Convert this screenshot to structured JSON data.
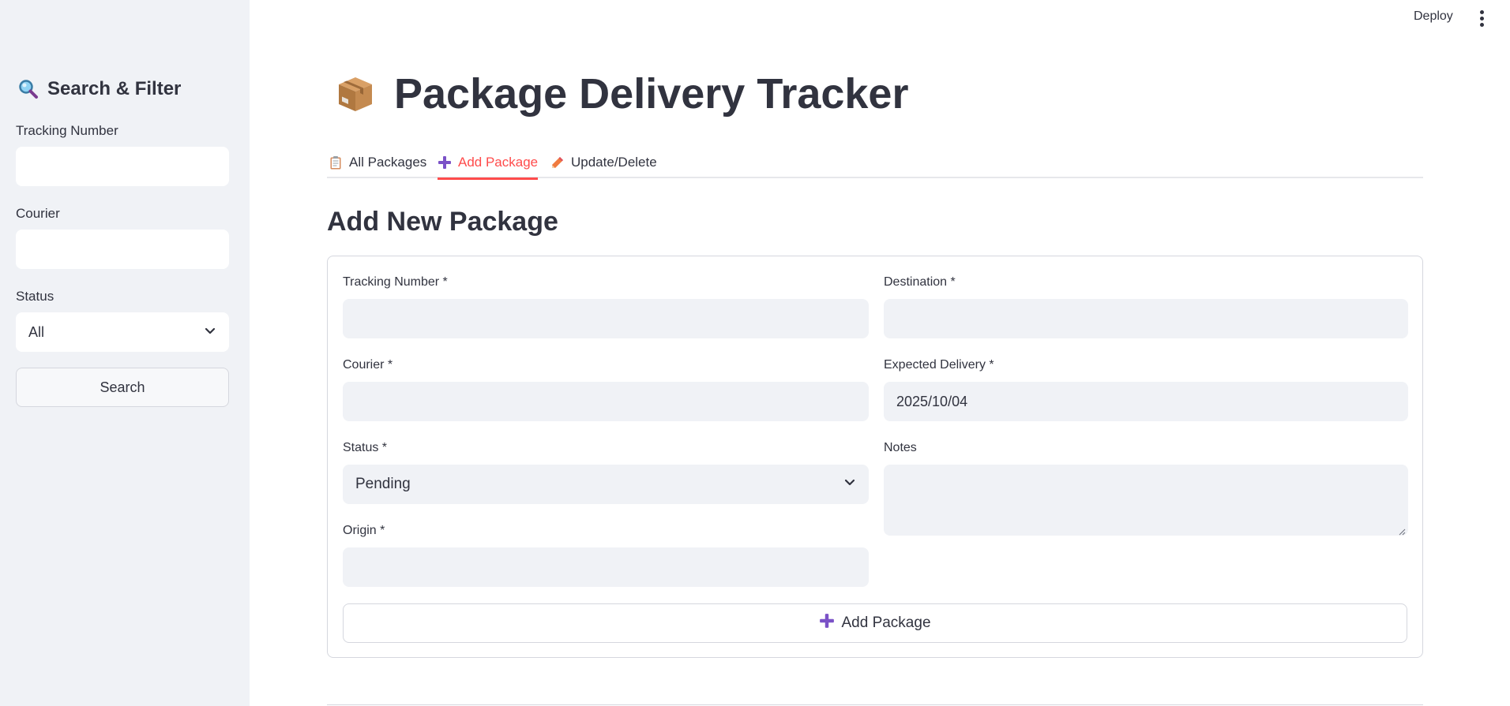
{
  "sidebar": {
    "title": "Search & Filter",
    "title_icon": "magnifier-icon",
    "tracking_label": "Tracking Number",
    "tracking_value": "",
    "courier_label": "Courier",
    "courier_value": "",
    "status_label": "Status",
    "status_value": "All",
    "search_button": "Search"
  },
  "header": {
    "deploy_label": "Deploy",
    "menu_icon": "kebab-menu-icon"
  },
  "main": {
    "title": "Package Delivery Tracker",
    "title_icon": "package-icon",
    "tabs": [
      {
        "label": "All Packages",
        "icon": "clipboard-icon",
        "active": false
      },
      {
        "label": "Add Package",
        "icon": "plus-icon",
        "active": true
      },
      {
        "label": "Update/Delete",
        "icon": "pencil-icon",
        "active": false
      }
    ],
    "section_title": "Add New Package",
    "form": {
      "tracking_label": "Tracking Number *",
      "tracking_value": "",
      "destination_label": "Destination *",
      "destination_value": "",
      "courier_label": "Courier *",
      "courier_value": "",
      "expected_label": "Expected Delivery *",
      "expected_value": "2025/10/04",
      "status_label": "Status *",
      "status_value": "Pending",
      "notes_label": "Notes",
      "notes_value": "",
      "origin_label": "Origin *",
      "origin_value": "",
      "submit_label": "Add Package"
    }
  },
  "colors": {
    "accent": "#ff4b4b",
    "sidebar_bg": "#f0f2f6",
    "input_bg": "#f0f2f6",
    "plus_purple": "#7b52c7"
  }
}
